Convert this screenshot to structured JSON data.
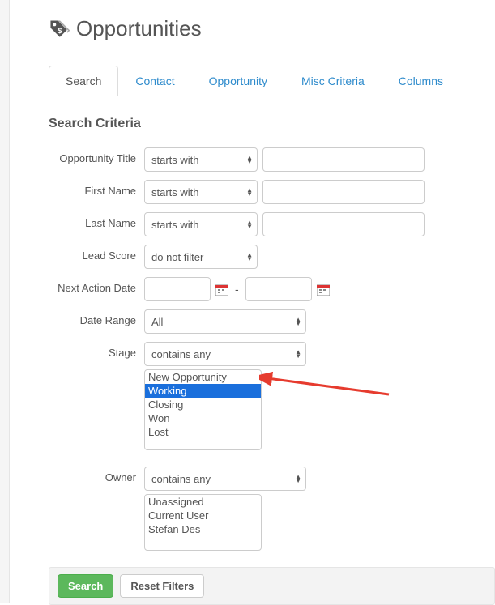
{
  "header": {
    "title": "Opportunities"
  },
  "tabs": [
    {
      "label": "Search",
      "active": true
    },
    {
      "label": "Contact",
      "active": false
    },
    {
      "label": "Opportunity",
      "active": false
    },
    {
      "label": "Misc Criteria",
      "active": false
    },
    {
      "label": "Columns",
      "active": false
    }
  ],
  "section": {
    "title": "Search Criteria"
  },
  "rows": {
    "opportunity_title": {
      "label": "Opportunity Title",
      "operator": "starts with",
      "value": ""
    },
    "first_name": {
      "label": "First Name",
      "operator": "starts with",
      "value": ""
    },
    "last_name": {
      "label": "Last Name",
      "operator": "starts with",
      "value": ""
    },
    "lead_score": {
      "label": "Lead Score",
      "operator": "do not filter"
    },
    "next_action_date": {
      "label": "Next Action Date",
      "from": "",
      "to": ""
    },
    "date_range": {
      "label": "Date Range",
      "value": "All"
    },
    "stage": {
      "label": "Stage",
      "operator": "contains any",
      "options": [
        "New Opportunity",
        "Working",
        "Closing",
        "Won",
        "Lost"
      ],
      "selected": "Working"
    },
    "owner": {
      "label": "Owner",
      "operator": "contains any",
      "options": [
        "Unassigned",
        "Current User",
        "Stefan Des"
      ]
    }
  },
  "footer": {
    "search": "Search",
    "reset": "Reset Filters"
  }
}
